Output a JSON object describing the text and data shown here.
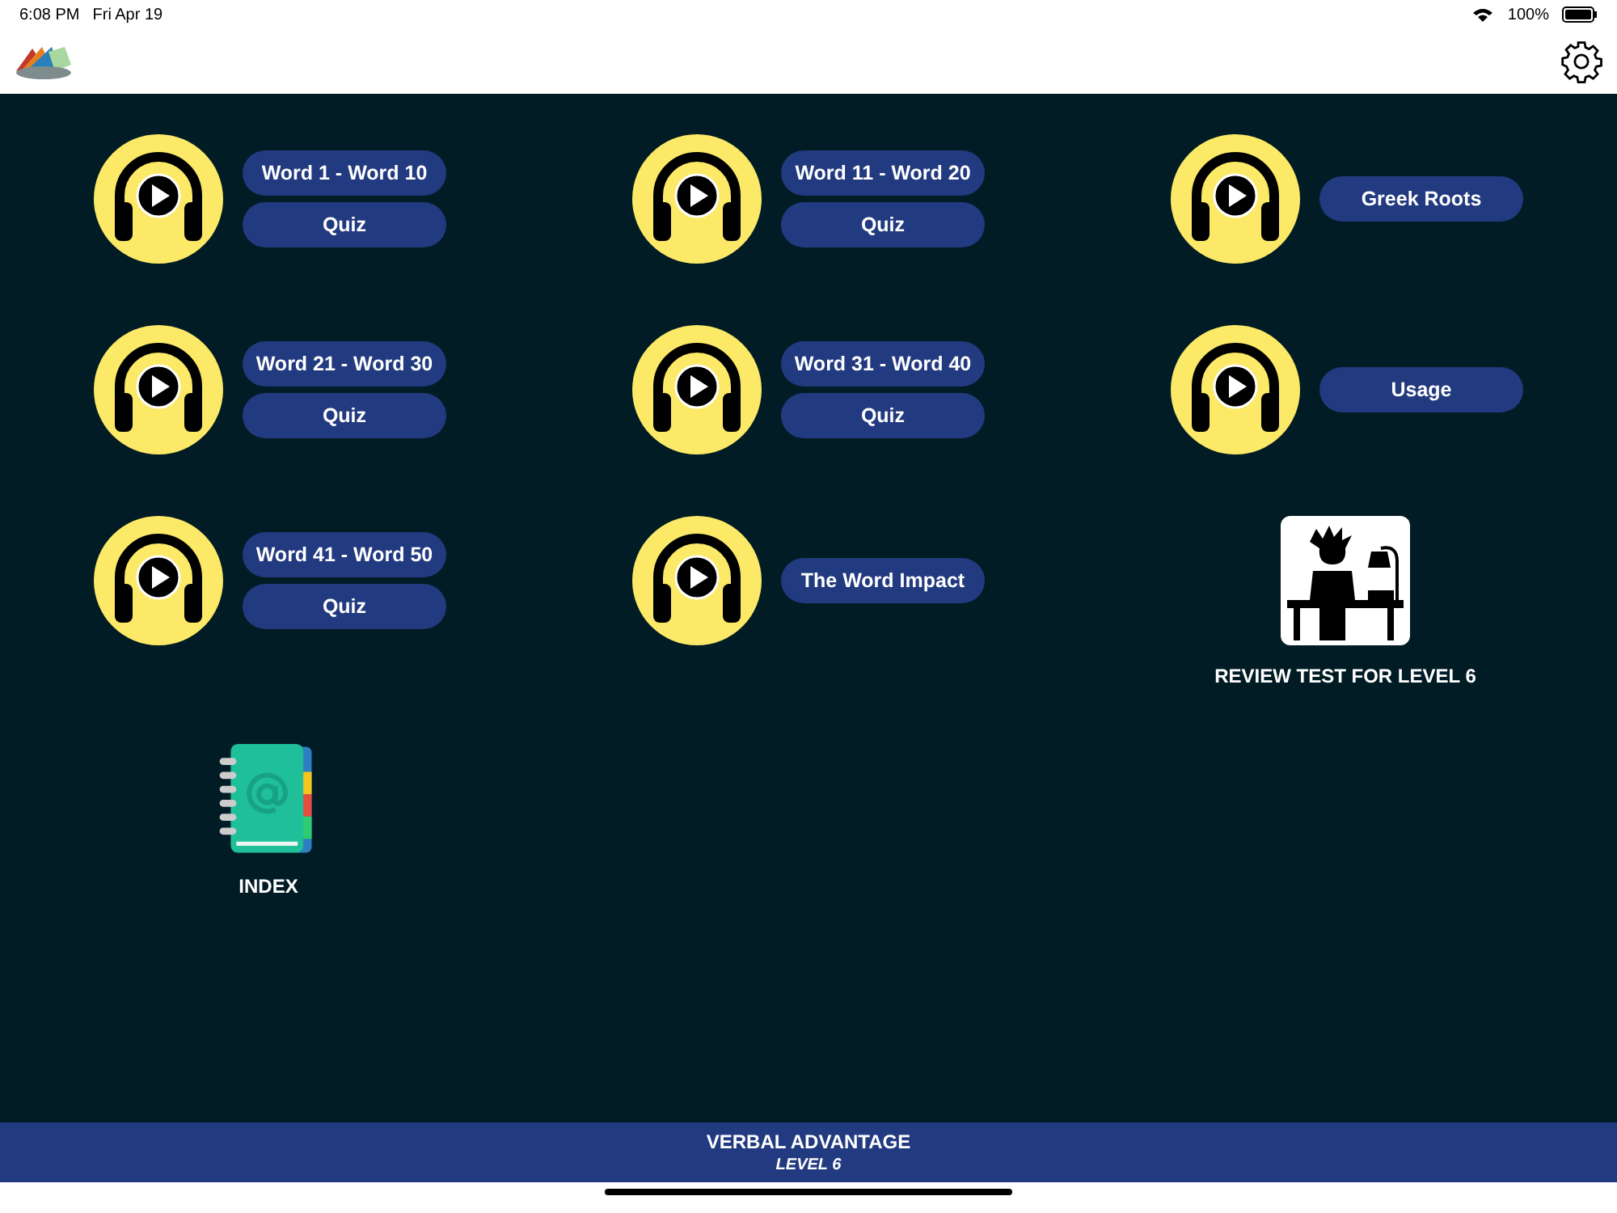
{
  "status_bar": {
    "time": "6:08 PM",
    "date": "Fri Apr 19",
    "battery": "100%"
  },
  "items": [
    {
      "kind": "audio",
      "buttons": [
        "Word 1 - Word 10",
        "Quiz"
      ]
    },
    {
      "kind": "audio",
      "buttons": [
        "Word 11 - Word 20",
        "Quiz"
      ]
    },
    {
      "kind": "audio",
      "buttons": [
        "Greek Roots"
      ]
    },
    {
      "kind": "audio",
      "buttons": [
        "Word 21 - Word 30",
        "Quiz"
      ]
    },
    {
      "kind": "audio",
      "buttons": [
        "Word 31 - Word 40",
        "Quiz"
      ]
    },
    {
      "kind": "audio",
      "buttons": [
        "Usage"
      ]
    },
    {
      "kind": "audio",
      "buttons": [
        "Word 41 - Word 50",
        "Quiz"
      ]
    },
    {
      "kind": "audio",
      "buttons": [
        "The Word Impact"
      ]
    },
    {
      "kind": "review",
      "label": "REVIEW TEST FOR LEVEL 6"
    },
    {
      "kind": "index",
      "label": "INDEX"
    }
  ],
  "footer": {
    "title": "VERBAL ADVANTAGE",
    "subtitle": "LEVEL 6"
  }
}
